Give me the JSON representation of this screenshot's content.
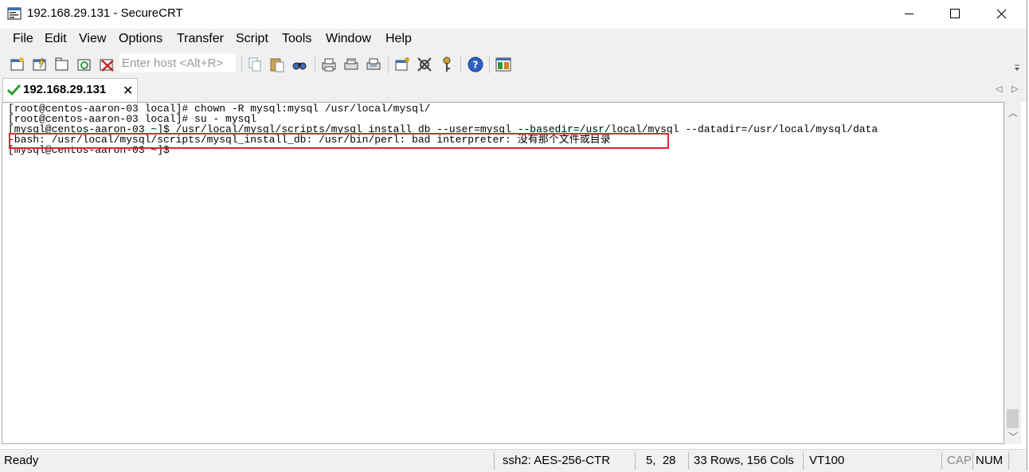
{
  "window": {
    "title": "192.168.29.131 - SecureCRT",
    "app_icon": "securecrt-icon",
    "controls": [
      "minimize-icon",
      "maximize-icon",
      "close-icon"
    ]
  },
  "menu": {
    "items": [
      "File",
      "Edit",
      "View",
      "Options",
      "Transfer",
      "Script",
      "Tools",
      "Window",
      "Help"
    ]
  },
  "toolbar": {
    "host_placeholder": "Enter host <Alt+R>",
    "icons": [
      "connect-icon",
      "quick-connect-icon",
      "connect-in-tab-icon",
      "reconnect-icon",
      "disconnect-icon",
      "copy-icon",
      "paste-icon",
      "find-icon",
      "print-icon",
      "print-setup-icon",
      "print-selection-icon",
      "session-options-icon",
      "global-options-icon",
      "keymap-editor-icon",
      "help-icon",
      "sftp-icon"
    ]
  },
  "tabs": [
    {
      "label": "192.168.29.131",
      "status_icon": "check-icon",
      "active": true
    }
  ],
  "terminal": {
    "lines": [
      "[root@centos-aaron-03 local]# chown -R mysql:mysql /usr/local/mysql/",
      "[root@centos-aaron-03 local]# su - mysql",
      "[mysql@centos-aaron-03 ~]$ /usr/local/mysql/scripts/mysql_install_db --user=mysql --basedir=/usr/local/mysql --datadir=/usr/local/mysql/data",
      "-bash: /usr/local/mysql/scripts/mysql_install_db: /usr/bin/perl: bad interpreter: 没有那个文件或目录",
      "[mysql@centos-aaron-03 ~]$ "
    ],
    "highlight_color": "#e2262a"
  },
  "status": {
    "state": "Ready",
    "protocol": "ssh2: AES-256-CTR",
    "cursor": "5,  28",
    "size": "33 Rows, 156 Cols",
    "emulation": "VT100",
    "caps": "CAP",
    "num": "NUM"
  }
}
